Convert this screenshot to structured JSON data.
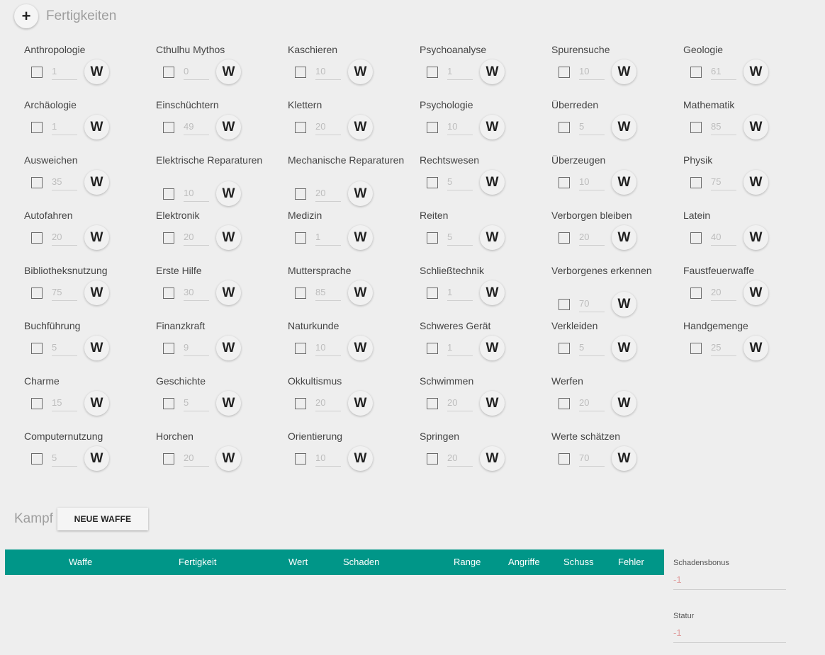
{
  "skills_section": {
    "title": "Fertigkeiten",
    "add_label": "+"
  },
  "roll_label": "W",
  "columns": [
    [
      {
        "name": "Anthropologie",
        "value": "1"
      },
      {
        "name": "Archäologie",
        "value": "1"
      },
      {
        "name": "Ausweichen",
        "value": "35"
      },
      {
        "name": "Autofahren",
        "value": "20"
      },
      {
        "name": "Bibliotheksnutzung",
        "value": "75"
      },
      {
        "name": "Buchführung",
        "value": "5"
      },
      {
        "name": "Charme",
        "value": "15"
      },
      {
        "name": "Computernutzung",
        "value": "5"
      }
    ],
    [
      {
        "name": "Cthulhu Mythos",
        "value": "0"
      },
      {
        "name": "Einschüchtern",
        "value": "49"
      },
      {
        "name": "Elektrische Reparaturen",
        "value": "10",
        "two": true
      },
      {
        "name": "Elektronik",
        "value": "20"
      },
      {
        "name": "Erste Hilfe",
        "value": "30"
      },
      {
        "name": "Finanzkraft",
        "value": "9"
      },
      {
        "name": "Geschichte",
        "value": "5"
      },
      {
        "name": "Horchen",
        "value": "20"
      }
    ],
    [
      {
        "name": "Kaschieren",
        "value": "10"
      },
      {
        "name": "Klettern",
        "value": "20"
      },
      {
        "name": "Mechanische Reparaturen",
        "value": "20",
        "two": true
      },
      {
        "name": "Medizin",
        "value": "1"
      },
      {
        "name": "Muttersprache",
        "value": "85"
      },
      {
        "name": "Naturkunde",
        "value": "10"
      },
      {
        "name": "Okkultismus",
        "value": "20"
      },
      {
        "name": "Orientierung",
        "value": "10"
      }
    ],
    [
      {
        "name": "Psychoanalyse",
        "value": "1"
      },
      {
        "name": "Psychologie",
        "value": "10"
      },
      {
        "name": "Rechtswesen",
        "value": "5"
      },
      {
        "name": "Reiten",
        "value": "5"
      },
      {
        "name": "Schließtechnik",
        "value": "1"
      },
      {
        "name": "Schweres Gerät",
        "value": "1"
      },
      {
        "name": "Schwimmen",
        "value": "20"
      },
      {
        "name": "Springen",
        "value": "20"
      }
    ],
    [
      {
        "name": "Spurensuche",
        "value": "10"
      },
      {
        "name": "Überreden",
        "value": "5"
      },
      {
        "name": "Überzeugen",
        "value": "10"
      },
      {
        "name": "Verborgen bleiben",
        "value": "20"
      },
      {
        "name": "Verborgenes erkennen",
        "value": "70",
        "two": true
      },
      {
        "name": "Verkleiden",
        "value": "5"
      },
      {
        "name": "Werfen",
        "value": "20"
      },
      {
        "name": "Werte schätzen",
        "value": "70"
      }
    ],
    [
      {
        "name": "Geologie",
        "value": "61"
      },
      {
        "name": "Mathematik",
        "value": "85"
      },
      {
        "name": "Physik",
        "value": "75"
      },
      {
        "name": "Latein",
        "value": "40"
      },
      {
        "name": "Faustfeuerwaffe",
        "value": "20"
      },
      {
        "name": "Handgemenge",
        "value": "25"
      }
    ]
  ],
  "combat": {
    "title": "Kampf",
    "new_weapon_label": "NEUE WAFFE"
  },
  "weapons_table": {
    "headers": [
      "Waffe",
      "Fertigkeit",
      "Wert",
      "Schaden",
      "Range",
      "Angriffe",
      "Schuss",
      "Fehler"
    ]
  },
  "side": {
    "damage_bonus_label": "Schadensbonus",
    "damage_bonus_value": "-1",
    "build_label": "Statur",
    "build_value": "-1"
  }
}
